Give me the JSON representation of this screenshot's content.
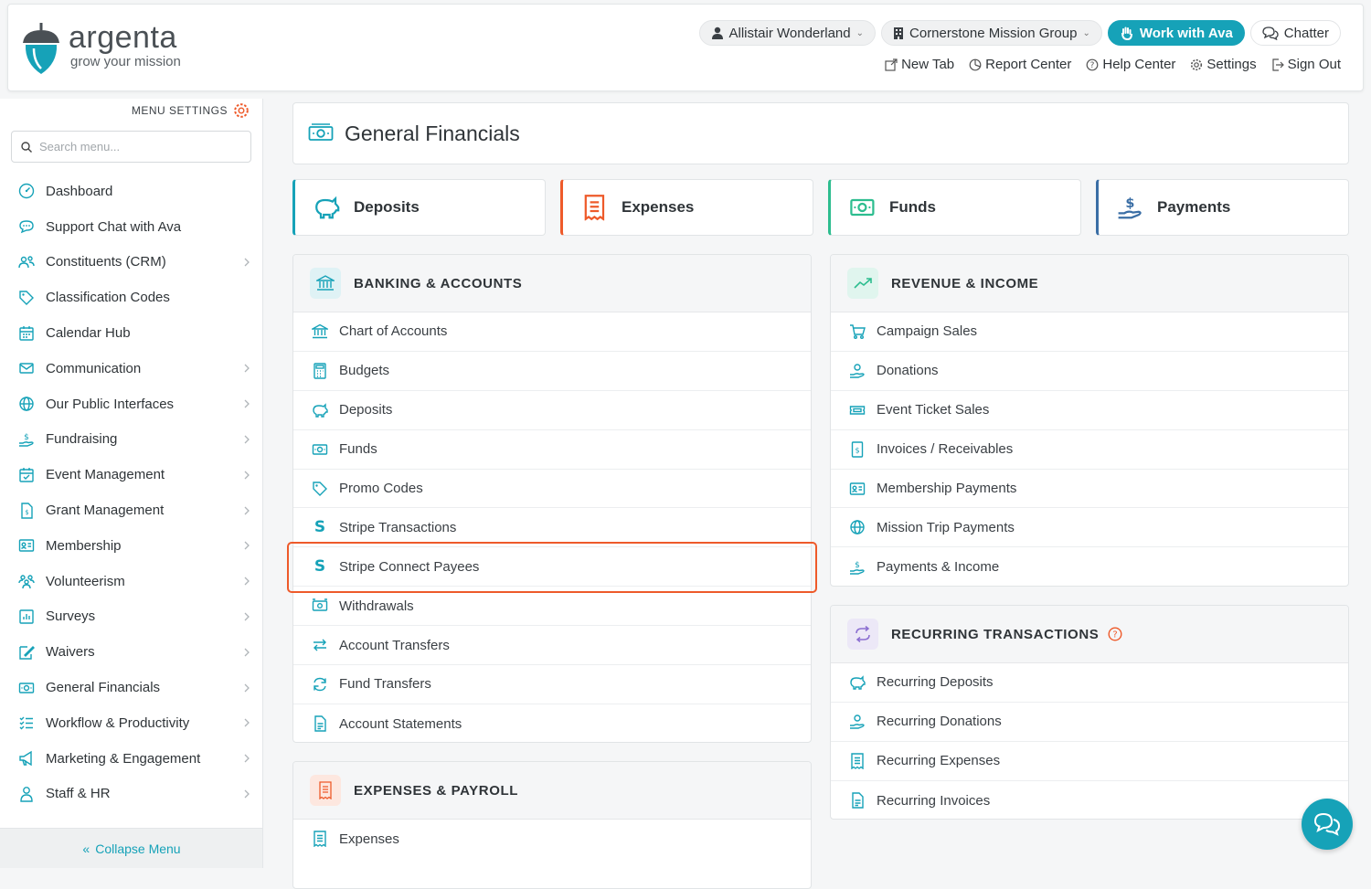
{
  "brand": {
    "name": "argenta",
    "tagline": "grow your mission",
    "accent": "#16a2b8"
  },
  "header": {
    "user_name": "Allistair Wonderland",
    "org_name": "Cornerstone Mission Group",
    "ava_label": "Work with Ava",
    "chatter_label": "Chatter",
    "links": {
      "new_tab": "New Tab",
      "report_center": "Report Center",
      "help_center": "Help Center",
      "settings": "Settings",
      "sign_out": "Sign Out"
    }
  },
  "sidebar": {
    "menu_settings_label": "MENU SETTINGS",
    "search_placeholder": "Search menu...",
    "collapse_label": "Collapse Menu",
    "items": [
      {
        "label": "Dashboard",
        "icon": "dashboard-icon",
        "chevron": false
      },
      {
        "label": "Support Chat with Ava",
        "icon": "chat-icon",
        "chevron": false
      },
      {
        "label": "Constituents (CRM)",
        "icon": "users-icon",
        "chevron": true
      },
      {
        "label": "Classification Codes",
        "icon": "tag-icon",
        "chevron": false
      },
      {
        "label": "Calendar Hub",
        "icon": "calendar-icon",
        "chevron": false
      },
      {
        "label": "Communication",
        "icon": "mail-icon",
        "chevron": true
      },
      {
        "label": "Our Public Interfaces",
        "icon": "globe-icon",
        "chevron": true
      },
      {
        "label": "Fundraising",
        "icon": "hand-dollar-icon",
        "chevron": true
      },
      {
        "label": "Event Management",
        "icon": "event-icon",
        "chevron": true
      },
      {
        "label": "Grant Management",
        "icon": "document-icon",
        "chevron": true
      },
      {
        "label": "Membership",
        "icon": "id-card-icon",
        "chevron": true
      },
      {
        "label": "Volunteerism",
        "icon": "group-icon",
        "chevron": true
      },
      {
        "label": "Surveys",
        "icon": "chart-icon",
        "chevron": true
      },
      {
        "label": "Waivers",
        "icon": "signature-icon",
        "chevron": true
      },
      {
        "label": "General Financials",
        "icon": "money-icon",
        "chevron": true
      },
      {
        "label": "Workflow & Productivity",
        "icon": "list-check-icon",
        "chevron": true
      },
      {
        "label": "Marketing & Engagement",
        "icon": "megaphone-icon",
        "chevron": true
      },
      {
        "label": "Staff & HR",
        "icon": "person-icon",
        "chevron": true
      }
    ]
  },
  "page": {
    "title": "General Financials",
    "quick_links": [
      {
        "label": "Deposits",
        "color": "#16a2b8",
        "icon": "piggy-bank-icon"
      },
      {
        "label": "Expenses",
        "color": "#ee5a2a",
        "icon": "receipt-icon"
      },
      {
        "label": "Funds",
        "color": "#2dbd8f",
        "icon": "money-icon"
      },
      {
        "label": "Payments",
        "color": "#3a6ea5",
        "icon": "hand-dollar-icon"
      }
    ],
    "banking": {
      "title": "BANKING & ACCOUNTS",
      "items": [
        "Chart of Accounts",
        "Budgets",
        "Deposits",
        "Funds",
        "Promo Codes",
        "Stripe Transactions",
        "Stripe Connect Payees",
        "Withdrawals",
        "Account Transfers",
        "Fund Transfers",
        "Account Statements"
      ]
    },
    "revenue": {
      "title": "REVENUE & INCOME",
      "items": [
        "Campaign Sales",
        "Donations",
        "Event Ticket Sales",
        "Invoices / Receivables",
        "Membership Payments",
        "Mission Trip Payments",
        "Payments & Income"
      ]
    },
    "recurring": {
      "title": "RECURRING TRANSACTIONS",
      "items": [
        "Recurring Deposits",
        "Recurring Donations",
        "Recurring Expenses",
        "Recurring Invoices"
      ]
    },
    "expenses": {
      "title": "EXPENSES & PAYROLL",
      "items": [
        "Expenses"
      ]
    }
  }
}
